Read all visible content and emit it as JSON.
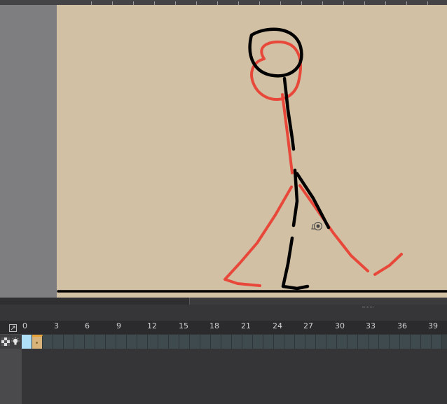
{
  "timeline": {
    "frame_numbers": [
      "0",
      "3",
      "6",
      "9",
      "12",
      "15",
      "18",
      "21",
      "24",
      "27",
      "30",
      "33",
      "36",
      "39"
    ],
    "current_frame": "1",
    "keyframe": "2"
  },
  "colors": {
    "canvas": "#d2c0a4",
    "current_drawing": "#000000",
    "onion_skin": "#e8483a",
    "keyframe": "#d8b47a",
    "current_frame_cell": "#aee0f7"
  },
  "icons": {
    "expand": "expand-icon",
    "layer_thumbnail": "checkerboard-icon",
    "visibility": "lightbulb-icon",
    "cursor": "move-cursor-icon"
  }
}
